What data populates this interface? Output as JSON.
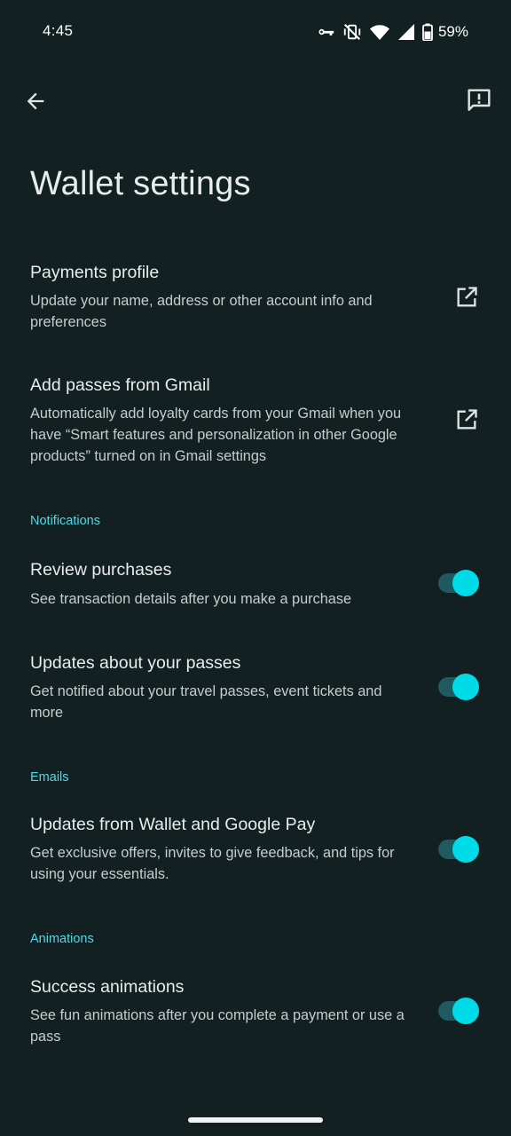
{
  "status_bar": {
    "time": "4:45",
    "battery_percent": "59%",
    "icons": [
      "vpn-key-icon",
      "vibrate-off-icon",
      "wifi-icon",
      "cell-signal-icon",
      "battery-icon"
    ]
  },
  "app_bar": {
    "back_icon": "arrow-back-icon",
    "feedback_icon": "feedback-icon"
  },
  "page": {
    "title": "Wallet settings"
  },
  "links": [
    {
      "title": "Payments profile",
      "description": "Update your name, address or other account info and preferences",
      "icon": "open-in-new-icon"
    },
    {
      "title": "Add passes from Gmail",
      "description": "Automatically add loyalty cards from your Gmail when you have “Smart features and personalization in other Google products” turned on in Gmail settings",
      "icon": "open-in-new-icon"
    }
  ],
  "sections": {
    "notifications": {
      "header": "Notifications",
      "items": [
        {
          "title": "Review purchases",
          "description": "See transaction details after you make a purchase",
          "enabled": true
        },
        {
          "title": "Updates about your passes",
          "description": "Get notified about your travel passes, event tickets and more",
          "enabled": true
        }
      ]
    },
    "emails": {
      "header": "Emails",
      "items": [
        {
          "title": "Updates from Wallet and Google Pay",
          "description": "Get exclusive offers, invites to give feedback, and tips for using your essentials.",
          "enabled": true
        }
      ]
    },
    "animations": {
      "header": "Animations",
      "items": [
        {
          "title": "Success animations",
          "description": "See fun animations after you complete a payment or use a pass",
          "enabled": true
        }
      ]
    }
  },
  "colors": {
    "background": "#122022",
    "accent": "#4fd8eb",
    "toggle_thumb": "#00dbe8",
    "toggle_track": "#1f5a61",
    "text_primary": "#e8eced",
    "text_secondary": "#c6cccd"
  }
}
